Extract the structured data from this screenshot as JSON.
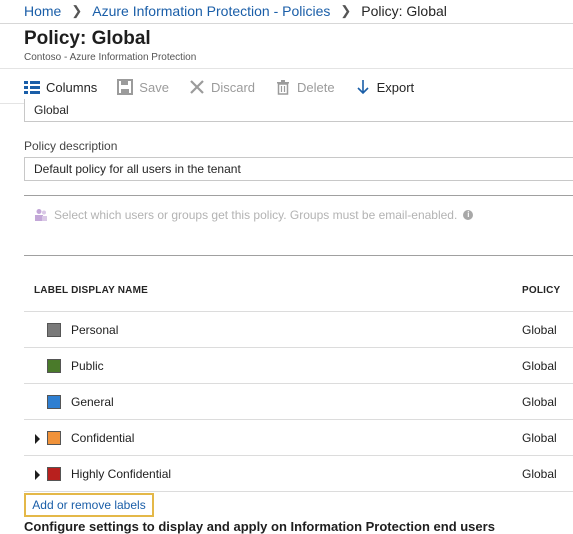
{
  "breadcrumb": {
    "home": "Home",
    "policies": "Azure Information Protection - Policies",
    "current": "Policy: Global"
  },
  "header": {
    "title": "Policy: Global",
    "subtitle": "Contoso - Azure Information Protection"
  },
  "toolbar": {
    "columns": "Columns",
    "save": "Save",
    "discard": "Discard",
    "delete": "Delete",
    "export": "Export"
  },
  "form": {
    "policy_name_value": "Global",
    "description_label": "Policy description",
    "description_value": "Default policy for all users in the tenant",
    "users_placeholder": "Select which users or groups get this policy. Groups must be email-enabled."
  },
  "table": {
    "col_label": "LABEL DISPLAY NAME",
    "col_policy": "POLICY",
    "rows": [
      {
        "name": "Personal",
        "policy": "Global",
        "color": "#7a7a7a",
        "expandable": false
      },
      {
        "name": "Public",
        "policy": "Global",
        "color": "#4a7a2a",
        "expandable": false
      },
      {
        "name": "General",
        "policy": "Global",
        "color": "#2f7fd1",
        "expandable": false
      },
      {
        "name": "Confidential",
        "policy": "Global",
        "color": "#f0923a",
        "expandable": true
      },
      {
        "name": "Highly Confidential",
        "policy": "Global",
        "color": "#b8201e",
        "expandable": true
      }
    ]
  },
  "actions": {
    "add_remove_labels": "Add or remove labels"
  },
  "footer": {
    "configure_heading": "Configure settings to display and apply on Information Protection end users"
  },
  "colors": {
    "link": "#1a5ea8",
    "highlight": "#e4b848"
  }
}
